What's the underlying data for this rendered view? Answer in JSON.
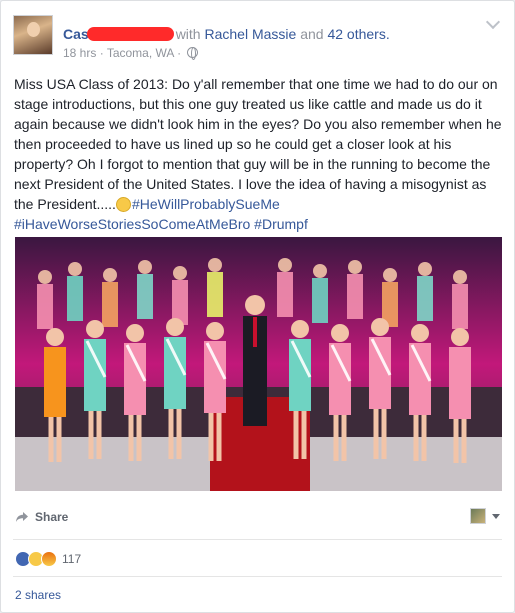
{
  "post": {
    "author_visible": "Cas",
    "with_text": "with",
    "tagged_person": "Rachel Massie",
    "and_text": "and",
    "others_link": "42 others.",
    "time": "18 hrs",
    "location": "Tacoma, WA",
    "meta_sep": "·",
    "body_text": "Miss USA Class of 2013: Do y'all remember that one time we had to do our on stage introductions, but this one guy treated us like cattle and made us do it again because we didn't look him in the eyes? Do you also remember when he then proceeded to have us lined up so he could get a closer look at his property? Oh I forgot to mention that guy will be in the running to become the next President of the United States. I love the idea of having a misogynist as the President.....",
    "hashtags": [
      "#HeWillProbablySueMe",
      "#iHaveWorseStoriesSoComeAtMeBro",
      "#Drumpf"
    ]
  },
  "actions": {
    "share_label": "Share"
  },
  "stats": {
    "reaction_count": "117",
    "shares_text": "2 shares"
  },
  "icons": [
    "chevron-down-icon",
    "globe-icon",
    "smiley-emoji-icon",
    "share-arrow-icon",
    "like-reaction-icon",
    "sad-reaction-icon",
    "angry-reaction-icon"
  ],
  "colors": {
    "link": "#365899",
    "redaction": "#ff2a2a",
    "meta": "#90949c"
  }
}
